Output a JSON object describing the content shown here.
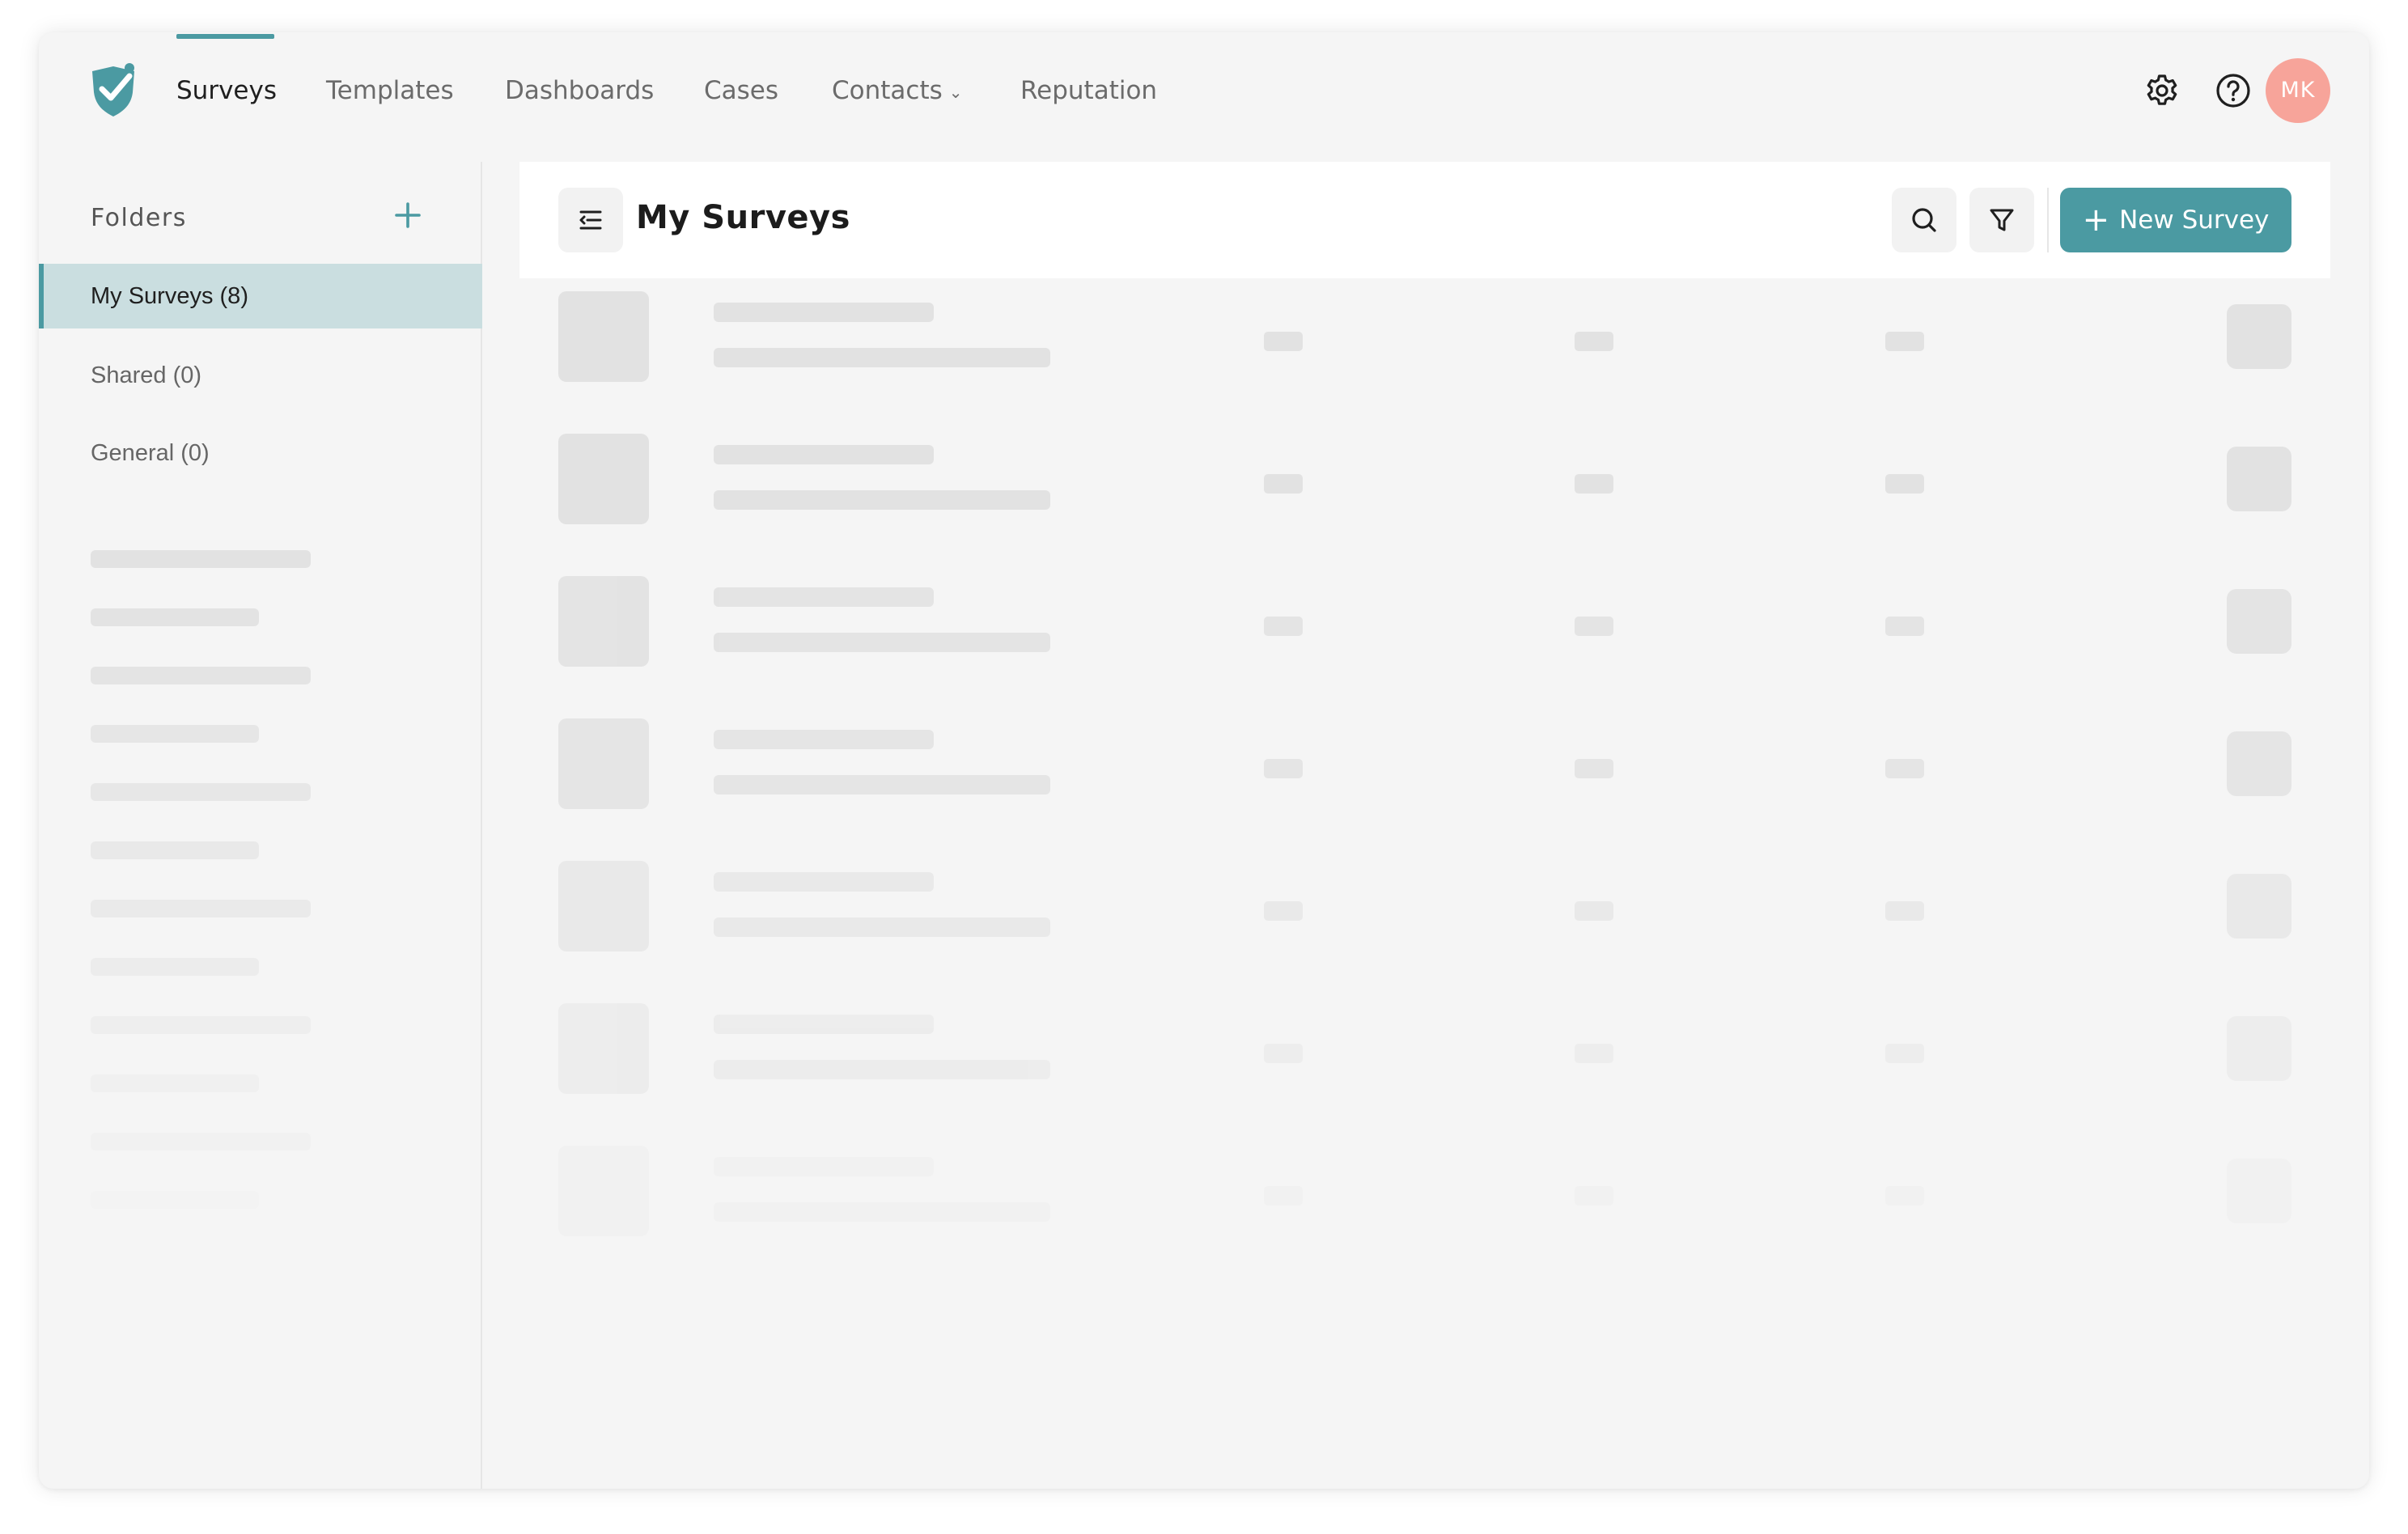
{
  "nav": {
    "items": [
      {
        "label": "Surveys"
      },
      {
        "label": "Templates"
      },
      {
        "label": "Dashboards"
      },
      {
        "label": "Cases"
      },
      {
        "label": "Contacts"
      },
      {
        "label": "Reputation"
      }
    ],
    "active": "Surveys",
    "avatar_initials": "MK"
  },
  "sidebar": {
    "heading": "Folders",
    "folders": [
      {
        "label": "My Surveys (8)"
      },
      {
        "label": "Shared (0)"
      },
      {
        "label": "General (0)"
      }
    ],
    "active_folder": "My Surveys (8)"
  },
  "main": {
    "title": "My Surveys",
    "new_button_label": "New Survey",
    "loading": true
  },
  "colors": {
    "accent": "#4b9aa2",
    "active_folder_bg": "#cadee0",
    "avatar_bg": "#f7a49a",
    "skeleton": "#e2e2e2"
  },
  "icons": [
    "logo-icon",
    "settings-icon",
    "help-icon",
    "plus-icon",
    "menu-collapse-icon",
    "search-icon",
    "filter-icon",
    "chevron-down-icon"
  ]
}
